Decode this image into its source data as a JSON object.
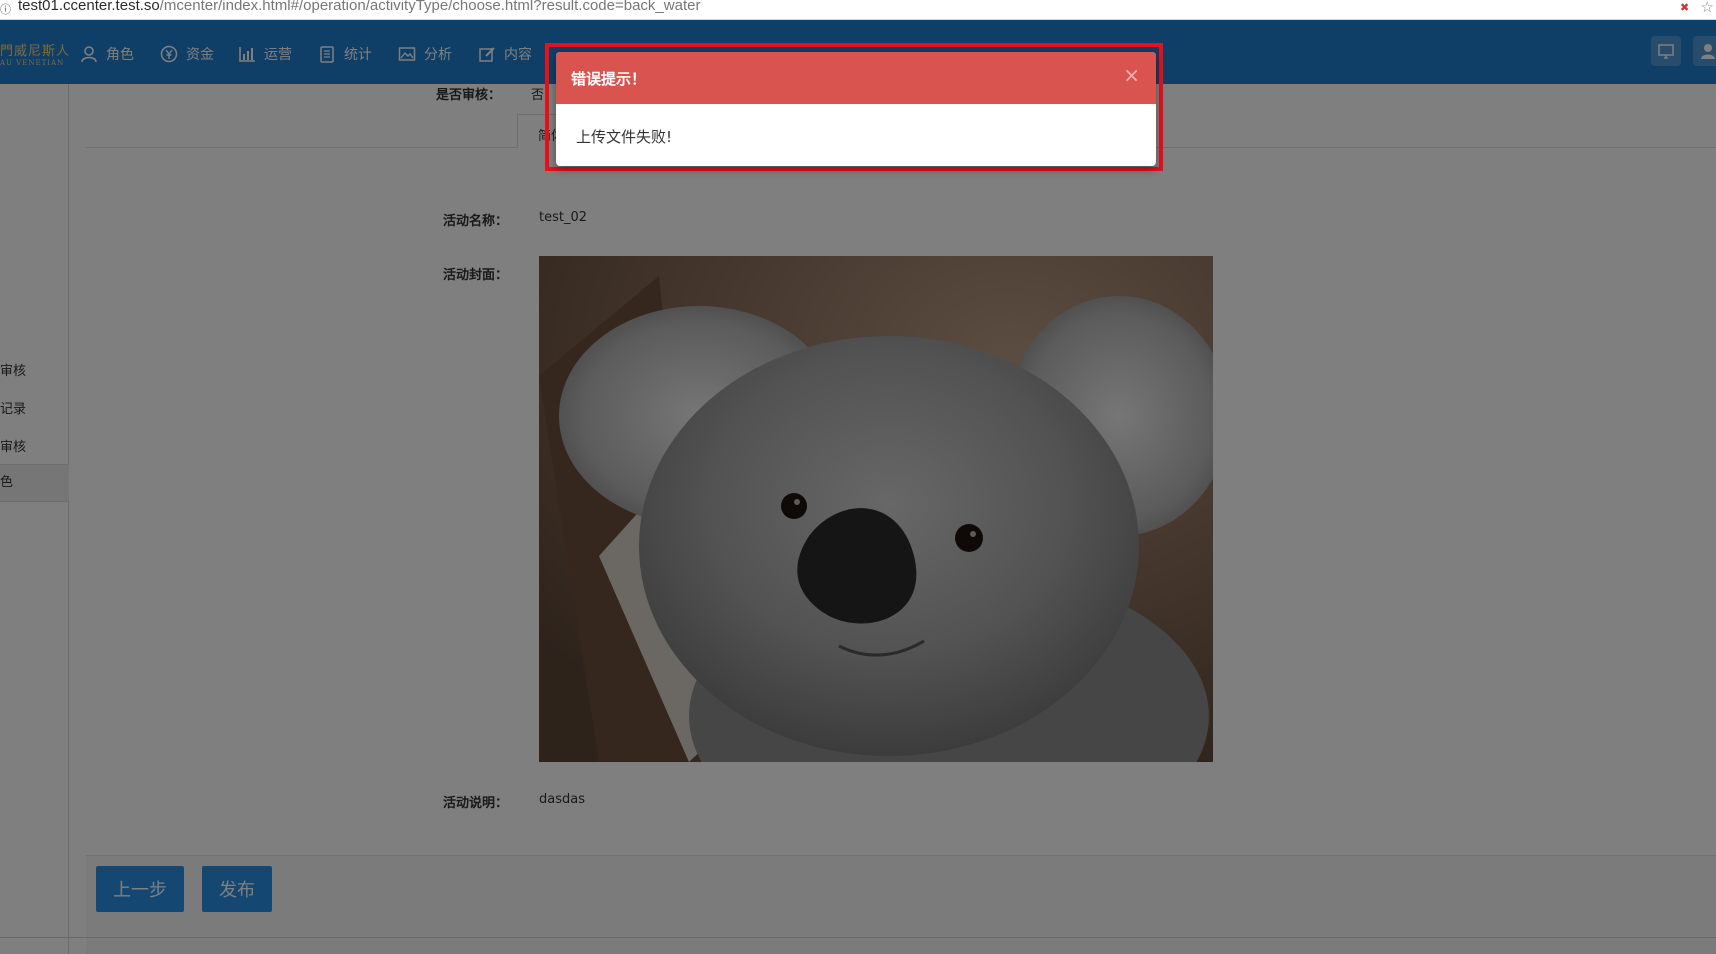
{
  "browser": {
    "url_host": "test01.ccenter.test.so",
    "url_path": "/mcenter/index.html#/operation/activityType/choose.html?result.code=back_water"
  },
  "topnav": {
    "logo_cn": "門威尼斯人",
    "logo_en": "AU VENETIAN",
    "items": [
      {
        "label": "角色",
        "icon": "user-icon"
      },
      {
        "label": "资金",
        "icon": "yen-icon"
      },
      {
        "label": "运营",
        "icon": "bar-chart-icon"
      },
      {
        "label": "统计",
        "icon": "list-icon"
      },
      {
        "label": "分析",
        "icon": "image-chart-icon"
      },
      {
        "label": "内容",
        "icon": "edit-icon"
      }
    ],
    "accent_color": "#1f7fcf"
  },
  "sidebar": {
    "items": [
      {
        "label": "审核"
      },
      {
        "label": "记录"
      },
      {
        "label": "审核"
      },
      {
        "label": "色"
      }
    ]
  },
  "form": {
    "review_label": "是否审核：",
    "review_value": "否",
    "tab_label": "简体",
    "name_label": "活动名称：",
    "name_value": "test_02",
    "cover_label": "活动封面：",
    "desc_label": "活动说明：",
    "desc_value": "dasdas"
  },
  "buttons": {
    "prev_label": "上一步",
    "publish_label": "发布"
  },
  "modal": {
    "title": "错误提示！",
    "close_symbol": "×",
    "message": "上传文件失败!",
    "header_color": "#d9534f",
    "highlight_color": "#e8101a"
  }
}
